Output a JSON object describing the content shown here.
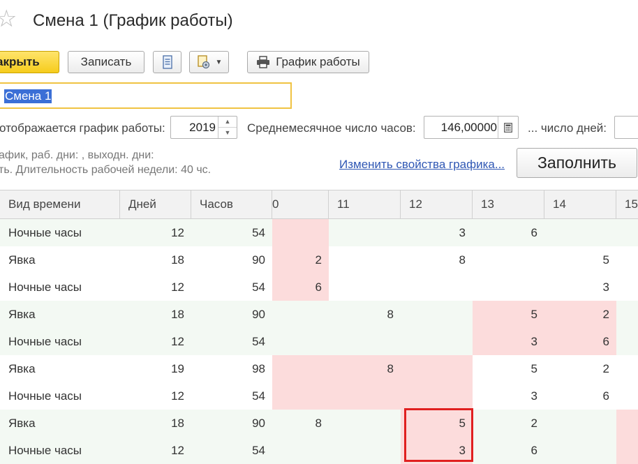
{
  "window": {
    "title": "Смена 1 (График работы)"
  },
  "toolbar": {
    "close_label": "акрыть",
    "save_label": "Записать",
    "print_label": "График работы",
    "doc_icon": "document-list-icon",
    "more_icon": "attachment-gear-icon",
    "print_icon": "printer-icon"
  },
  "name_field": {
    "value": "Смена 1"
  },
  "filters": {
    "year_label": "отображается график работы:",
    "year_value": "2019",
    "avg_hours_label": "Среднемесячное число часов:",
    "avg_hours_value": "146,00000",
    "days_label": "... число дней:"
  },
  "info": {
    "line1": "афик, раб. дни: , выходн. дни:",
    "line2": "ть. Длительность рабочей недели: 40 чс."
  },
  "link": {
    "label": "Изменить свойства графика..."
  },
  "fill_button": {
    "label": "Заполнить"
  },
  "colors": {
    "pink": "#fcdcdc",
    "green": "#f2f9f2",
    "accent": "#f6cc1c",
    "highlight": "#e02020"
  },
  "table": {
    "columns": [
      "Вид времени",
      "Дней",
      "Часов",
      "0",
      "11",
      "12",
      "13",
      "14",
      "15"
    ],
    "rows": [
      {
        "type": "Ночные часы",
        "days": "12",
        "hours": "54",
        "d10": "",
        "d11": "",
        "d12": "3",
        "d13": "6",
        "d14": "",
        "d15": ""
      },
      {
        "type": "Явка",
        "days": "18",
        "hours": "90",
        "d10": "2",
        "d11": "",
        "d12": "8",
        "d13": "",
        "d14": "5",
        "d15": ""
      },
      {
        "type": "Ночные часы",
        "days": "12",
        "hours": "54",
        "d10": "6",
        "d11": "",
        "d12": "",
        "d13": "",
        "d14": "3",
        "d15": ""
      },
      {
        "type": "Явка",
        "days": "18",
        "hours": "90",
        "d10": "",
        "d11": "8",
        "d12": "",
        "d13": "5",
        "d14": "2",
        "d15": ""
      },
      {
        "type": "Ночные часы",
        "days": "12",
        "hours": "54",
        "d10": "",
        "d11": "",
        "d12": "",
        "d13": "3",
        "d14": "6",
        "d15": ""
      },
      {
        "type": "Явка",
        "days": "19",
        "hours": "98",
        "d10": "",
        "d11": "8",
        "d12": "",
        "d13": "5",
        "d14": "2",
        "d15": ""
      },
      {
        "type": "Ночные часы",
        "days": "12",
        "hours": "54",
        "d10": "",
        "d11": "",
        "d12": "",
        "d13": "3",
        "d14": "6",
        "d15": ""
      },
      {
        "type": "Явка",
        "days": "18",
        "hours": "90",
        "d10": "8",
        "d11": "",
        "d12": "5",
        "d13": "2",
        "d14": "",
        "d15": ""
      },
      {
        "type": "Ночные часы",
        "days": "12",
        "hours": "54",
        "d10": "",
        "d11": "",
        "d12": "3",
        "d13": "6",
        "d14": "",
        "d15": ""
      }
    ]
  }
}
